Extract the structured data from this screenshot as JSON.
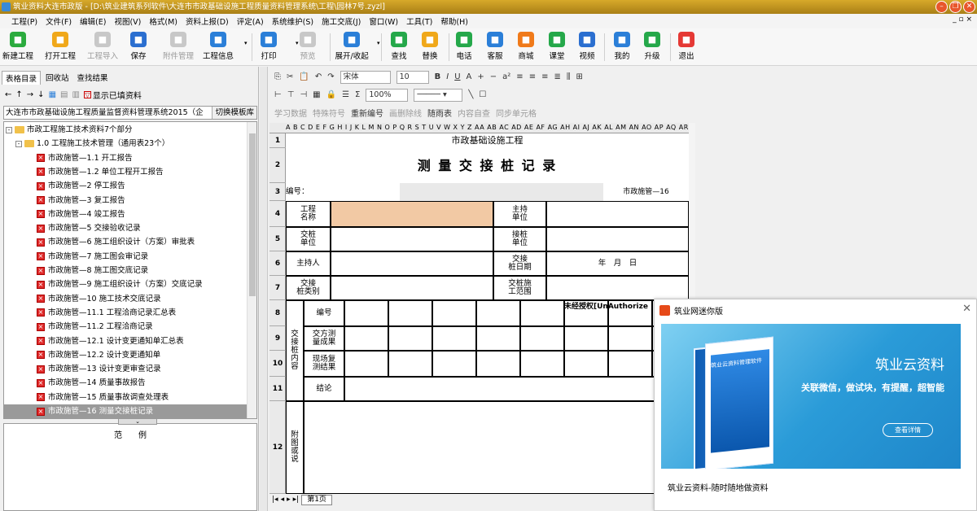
{
  "window": {
    "title": "筑业资料大连市政版 - [D:\\筑业建筑系列软件\\大连市市政基础设施工程质量资料管理系统\\工程\\园林7号.zyzl]"
  },
  "menu": [
    "工程(P)",
    "文件(F)",
    "编辑(E)",
    "视图(V)",
    "格式(M)",
    "资料上报(D)",
    "评定(A)",
    "系统维护(S)",
    "施工交底(J)",
    "窗口(W)",
    "工具(T)",
    "帮助(H)"
  ],
  "ribbon": [
    {
      "label": "新建工程",
      "icon": "new-project-icon",
      "color": "#2bab3e"
    },
    {
      "label": "打开工程",
      "icon": "open-folder-icon",
      "color": "#f0a81a"
    },
    {
      "label": "工程导入",
      "icon": "import-icon",
      "color": "#c8c8c8",
      "disabled": true
    },
    {
      "label": "保存",
      "icon": "save-icon",
      "color": "#2b6fd0"
    },
    {
      "label": "附件管理",
      "icon": "attachment-icon",
      "color": "#c8c8c8",
      "disabled": true
    },
    {
      "label": "工程信息",
      "icon": "project-info-icon",
      "color": "#2b7fd8"
    },
    {
      "label": "打印",
      "icon": "print-icon",
      "color": "#2b7fd8"
    },
    {
      "label": "预览",
      "icon": "preview-icon",
      "color": "#c8c8c8",
      "disabled": true
    },
    {
      "label": "展开/收起",
      "icon": "expand-collapse-icon",
      "color": "#2b7fd8"
    },
    {
      "label": "查找",
      "icon": "find-icon",
      "color": "#25a84a"
    },
    {
      "label": "替换",
      "icon": "replace-icon",
      "color": "#f0a81a"
    },
    {
      "label": "电话",
      "icon": "phone-icon",
      "color": "#25a84a"
    },
    {
      "label": "客服",
      "icon": "customer-service-icon",
      "color": "#2b7fd8"
    },
    {
      "label": "商城",
      "icon": "shop-icon",
      "color": "#f07a1a"
    },
    {
      "label": "课堂",
      "icon": "classroom-icon",
      "color": "#25a84a"
    },
    {
      "label": "视频",
      "icon": "video-icon",
      "color": "#2b6fd0"
    },
    {
      "label": "我的",
      "icon": "user-icon",
      "color": "#2b7fd8"
    },
    {
      "label": "升级",
      "icon": "upgrade-icon",
      "color": "#25a84a"
    },
    {
      "label": "退出",
      "icon": "exit-icon",
      "color": "#e53935"
    }
  ],
  "left": {
    "tabs": [
      "表格目录",
      "回收站",
      "查找结果"
    ],
    "show_filled": "显示已填资料",
    "path": "大连市市政基础设施工程质量监督资料管理系统2015（企",
    "switch_template": "切换模板库",
    "tree": [
      {
        "text": "市政工程施工技术资料7个部分",
        "level": 0,
        "type": "folder",
        "pm": "-"
      },
      {
        "text": "1.0 工程施工技术管理（通用表23个）",
        "level": 1,
        "type": "folder",
        "pm": "-"
      },
      {
        "text": "市政施管—1.1 开工报告",
        "level": 2,
        "type": "doc"
      },
      {
        "text": "市政施管—1.2 单位工程开工报告",
        "level": 2,
        "type": "doc"
      },
      {
        "text": "市政施管—2 停工报告",
        "level": 2,
        "type": "doc"
      },
      {
        "text": "市政施管—3 复工报告",
        "level": 2,
        "type": "doc"
      },
      {
        "text": "市政施管—4 竣工报告",
        "level": 2,
        "type": "doc"
      },
      {
        "text": "市政施管—5 交接验收记录",
        "level": 2,
        "type": "doc"
      },
      {
        "text": "市政施管—6 施工组织设计（方案）审批表",
        "level": 2,
        "type": "doc"
      },
      {
        "text": "市政施管—7 施工图会审记录",
        "level": 2,
        "type": "doc"
      },
      {
        "text": "市政施管—8 施工图交底记录",
        "level": 2,
        "type": "doc"
      },
      {
        "text": "市政施管—9 施工组织设计（方案）交底记录",
        "level": 2,
        "type": "doc"
      },
      {
        "text": "市政施管—10 施工技术交底记录",
        "level": 2,
        "type": "doc"
      },
      {
        "text": "市政施管—11.1 工程洽商记录汇总表",
        "level": 2,
        "type": "doc"
      },
      {
        "text": "市政施管—11.2 工程洽商记录",
        "level": 2,
        "type": "doc"
      },
      {
        "text": "市政施管—12.1 设计变更通知单汇总表",
        "level": 2,
        "type": "doc"
      },
      {
        "text": "市政施管—12.2 设计变更通知单",
        "level": 2,
        "type": "doc"
      },
      {
        "text": "市政施管—13 设计变更审查记录",
        "level": 2,
        "type": "doc"
      },
      {
        "text": "市政施管—14 质量事故报告",
        "level": 2,
        "type": "doc"
      },
      {
        "text": "市政施管—15 质量事故调查处理表",
        "level": 2,
        "type": "doc"
      },
      {
        "text": "市政施管—16 测量交接桩记录",
        "level": 2,
        "type": "doc",
        "selected": true
      }
    ],
    "example_title": "范　　例"
  },
  "format_toolbar": {
    "font": "宋体",
    "size": "10",
    "zoom": "100%"
  },
  "toolbar3": [
    "学习数据",
    "特殊符号",
    "重新编号",
    "画删除线",
    "随雨表",
    "内容自查",
    "同步单元格"
  ],
  "sheet": {
    "col_header": "A B C D E F G H I J K L M N O P Q R S T U V W X Y Z AA AB AC AD AE AF AG AH AI AJ AK AL AM AN AO AP AQ AR AS AT",
    "row_numbers": [
      "1",
      "2",
      "3",
      "4",
      "5",
      "6",
      "7",
      "8",
      "9",
      "10",
      "11",
      "12"
    ],
    "org": "市政基础设施工程",
    "title": "测 量 交 接 桩 记 录",
    "code_label": "编号：",
    "form_code": "市政施管—16",
    "project_name": "工程\n名称",
    "host_unit": "主持\n单位",
    "handover_unit": "交桩\n单位",
    "receive_unit": "接桩\n单位",
    "host_person": "主持人",
    "handover_date": "交接\n桩日期",
    "date_value": "年　月　日",
    "pile_type": "交接\n桩类别",
    "handover_scope": "交桩施\n工范围",
    "side_label": "交\n接\n桩\n内\n容",
    "row_code": "编号",
    "row_result": "交方测\n量成果",
    "row_recheck": "现场复\n测结果",
    "row_conclusion": "结论",
    "unauthorized": "未经授权[UnAuthorize",
    "attach_label": "附\n图\n或\n说"
  },
  "sheet_tab": "第1页",
  "popup": {
    "title": "筑业网迷你版",
    "brand": "筑业云资料",
    "slogan": "关联微信，做试块，有提醒，超智能",
    "button": "查看详情",
    "box_text": "筑业云资料管理软件",
    "footer": "筑业云资料-随时随地做资料"
  }
}
